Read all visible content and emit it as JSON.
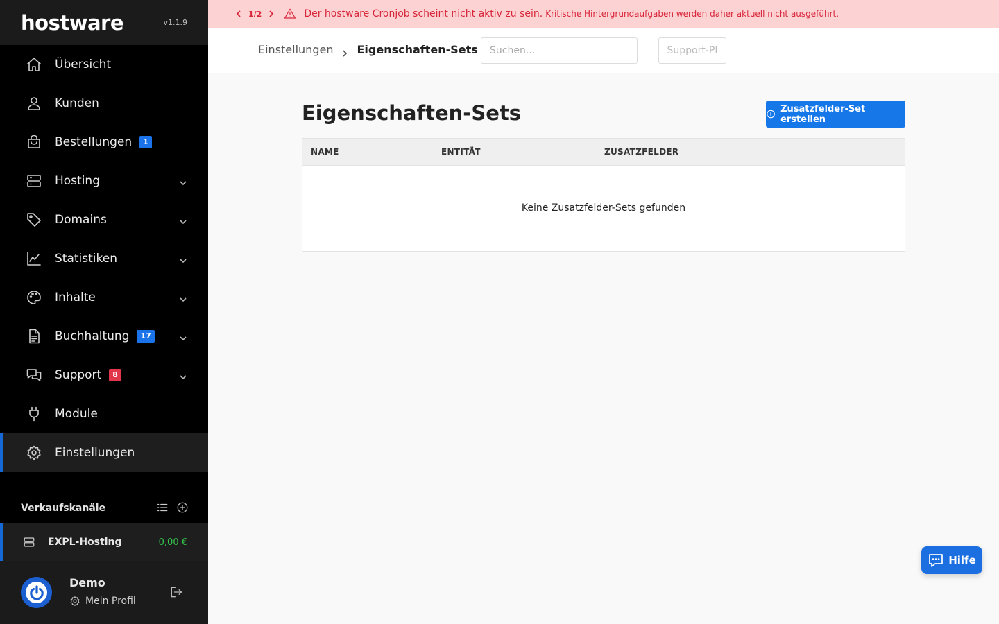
{
  "brand": {
    "logo": "hostware",
    "version": "v1.1.9"
  },
  "sidebar": {
    "items": [
      {
        "label": "Übersicht",
        "icon": "home-icon",
        "badge": "",
        "badge_color": "",
        "expandable": false,
        "active": false
      },
      {
        "label": "Kunden",
        "icon": "user-icon",
        "badge": "",
        "badge_color": "",
        "expandable": false,
        "active": false
      },
      {
        "label": "Bestellungen",
        "icon": "shopping-bag-icon",
        "badge": "1",
        "badge_color": "blue",
        "expandable": false,
        "active": false
      },
      {
        "label": "Hosting",
        "icon": "server-icon",
        "badge": "",
        "badge_color": "",
        "expandable": true,
        "active": false
      },
      {
        "label": "Domains",
        "icon": "tag-icon",
        "badge": "",
        "badge_color": "",
        "expandable": true,
        "active": false
      },
      {
        "label": "Statistiken",
        "icon": "chart-icon",
        "badge": "",
        "badge_color": "",
        "expandable": true,
        "active": false
      },
      {
        "label": "Inhalte",
        "icon": "palette-icon",
        "badge": "",
        "badge_color": "",
        "expandable": true,
        "active": false
      },
      {
        "label": "Buchhaltung",
        "icon": "document-icon",
        "badge": "17",
        "badge_color": "blue",
        "expandable": true,
        "active": false
      },
      {
        "label": "Support",
        "icon": "chat-icon",
        "badge": "8",
        "badge_color": "red",
        "expandable": true,
        "active": false
      },
      {
        "label": "Module",
        "icon": "plug-icon",
        "badge": "",
        "badge_color": "",
        "expandable": false,
        "active": false
      },
      {
        "label": "Einstellungen",
        "icon": "gear-icon",
        "badge": "",
        "badge_color": "",
        "expandable": false,
        "active": true
      }
    ],
    "channels_title": "Verkaufskanäle",
    "channel": {
      "name": "EXPL-Hosting",
      "amount": "0,00 €"
    },
    "profile": {
      "name": "Demo",
      "link": "Mein Profil"
    }
  },
  "alert": {
    "pager": "1/2",
    "message": "Der hostware Cronjob scheint nicht aktiv zu sein.",
    "detail": "Kritische Hintergrundaufgaben werden daher aktuell nicht ausgeführt."
  },
  "topbar": {
    "breadcrumb_parent": "Einstellungen",
    "breadcrumb_current": "Eigenschaften-Sets",
    "search_placeholder": "Suchen...",
    "support_label": "Support-PI"
  },
  "main": {
    "title": "Eigenschaften-Sets",
    "create_button": "Zusatzfelder-Set erstellen",
    "columns": [
      "NAME",
      "ENTITÄT",
      "ZUSATZFELDER"
    ],
    "empty_text": "Keine Zusatzfelder-Sets gefunden"
  },
  "help": {
    "label": "Hilfe"
  },
  "colors": {
    "accent": "#1677e8",
    "alert_bg": "#fdd2d2",
    "alert_text": "#d8263b",
    "sidebar_bg": "#000000",
    "amount": "#35c44c"
  }
}
